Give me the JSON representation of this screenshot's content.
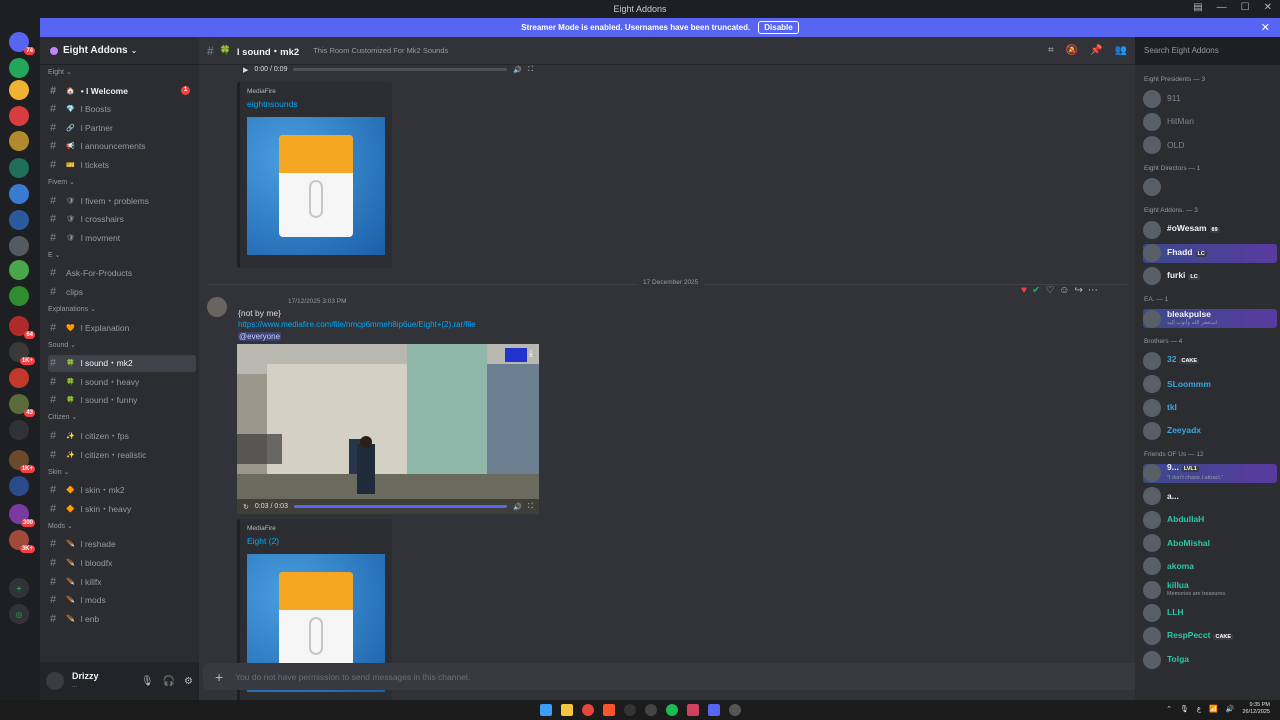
{
  "window": {
    "title": "Eight Addons"
  },
  "banner": {
    "text": "Streamer Mode is enabled. Usernames have been truncated.",
    "button": "Disable"
  },
  "server_rail": [
    {
      "badge": "74",
      "color": "#5865f2"
    },
    {
      "badge": "",
      "color": "#23a55a"
    },
    {
      "badge": "",
      "color": "#f0b232"
    },
    {
      "badge": "",
      "color": "#d83c3e"
    },
    {
      "badge": "",
      "color": "#b08a2c"
    },
    {
      "badge": "",
      "color": "#1f6e5a"
    },
    {
      "badge": "",
      "color": "#3a7ad0"
    },
    {
      "badge": "",
      "color": "#2a5a9c"
    },
    {
      "badge": "",
      "color": "#555a60"
    },
    {
      "badge": "",
      "color": "#4aa64a"
    },
    {
      "badge": "",
      "color": "#2f8c2f"
    },
    {
      "badge": "64",
      "color": "#b02a2a"
    },
    {
      "badge": "1K+",
      "color": "#3a3a3a"
    },
    {
      "badge": "",
      "color": "#c0392b"
    },
    {
      "badge": "43",
      "color": "#5a6a3a"
    },
    {
      "badge": "",
      "color": "#303238"
    },
    {
      "badge": "1K+",
      "color": "#6a4a2a"
    },
    {
      "badge": "",
      "color": "#2a4a8a"
    },
    {
      "badge": "300",
      "color": "#7a3aa0"
    },
    {
      "badge": "3K+",
      "color": "#a04a3a"
    }
  ],
  "sidebar": {
    "server_name": "Eight Addons",
    "categories": [
      {
        "name": "Eight",
        "channels": [
          {
            "name": "• l Welcome",
            "icon": "🏠",
            "bold": true,
            "badge": "1"
          },
          {
            "name": "l Boosts",
            "icon": "💎"
          },
          {
            "name": "l Partner",
            "icon": "🔗"
          },
          {
            "name": "l announcements",
            "icon": "📢"
          },
          {
            "name": "l tickets",
            "icon": "🎫"
          }
        ]
      },
      {
        "name": "Fivem",
        "channels": [
          {
            "name": "l fivem・problems",
            "icon": "🛡"
          },
          {
            "name": "l crosshairs",
            "icon": "🛡"
          },
          {
            "name": "l movment",
            "icon": "🛡"
          }
        ]
      },
      {
        "name": "E",
        "channels": [
          {
            "name": "Ask-For-Products",
            "icon": ""
          },
          {
            "name": "clips",
            "icon": ""
          }
        ]
      },
      {
        "name": "Explanations",
        "channels": [
          {
            "name": "l Explanation",
            "icon": "🧡"
          }
        ]
      },
      {
        "name": "Sound",
        "channels": [
          {
            "name": "l sound・mk2",
            "icon": "🍀",
            "active": true
          },
          {
            "name": "l sound・heavy",
            "icon": "🍀"
          },
          {
            "name": "l sound・funny",
            "icon": "🍀"
          }
        ]
      },
      {
        "name": "Citizen",
        "channels": [
          {
            "name": "l citizen・fps",
            "icon": "✨"
          },
          {
            "name": "l citizen・realistic",
            "icon": "✨"
          }
        ]
      },
      {
        "name": "Skin",
        "channels": [
          {
            "name": "l skin・mk2",
            "icon": "🔶"
          },
          {
            "name": "l skin・heavy",
            "icon": "🔶"
          }
        ]
      },
      {
        "name": "Mods",
        "channels": [
          {
            "name": "l reshade",
            "icon": "🪶"
          },
          {
            "name": "l bloodfx",
            "icon": "🪶"
          },
          {
            "name": "l killfx",
            "icon": "🪶"
          },
          {
            "name": "l mods",
            "icon": "🪶"
          },
          {
            "name": "l enb",
            "icon": "🪶"
          }
        ]
      }
    ],
    "user": {
      "name": "Drizzy",
      "status": "..."
    }
  },
  "header": {
    "channel": "l sound・mk2",
    "topic": "This Room Customized For Mk2 Sounds"
  },
  "search": {
    "placeholder": "Search Eight Addons"
  },
  "chat": {
    "audio1": {
      "time": "0:00 / 0:09",
      "progress": 0
    },
    "embed1": {
      "provider": "MediaFire",
      "title": "eightnsounds"
    },
    "date_divider": "17 December 2025",
    "message": {
      "timestamp": "17/12/2025 3:03 PM",
      "text": "{not by me}",
      "url": "https://www.mediafire.com/file/nmcp6mmeh8ip6ue/Eight+(2).rar/file",
      "mention": "@everyone"
    },
    "video": {
      "time": "0:03 / 0:03",
      "progress": 1
    },
    "embed2": {
      "provider": "MediaFire",
      "title": "Eight (2)"
    },
    "input_placeholder": "You do not have permission to send messages in this channel."
  },
  "members": [
    {
      "group": "Eight Presidents — 3",
      "list": [
        {
          "name": "911",
          "color": "#80848e"
        },
        {
          "name": "HitMan",
          "color": "#80848e"
        },
        {
          "name": "OLD",
          "color": "#80848e"
        }
      ]
    },
    {
      "group": "Eight Directors — 1",
      "list": [
        {
          "name": "",
          "color": "#80848e"
        }
      ]
    },
    {
      "group": "Eight Addons. — 3",
      "list": [
        {
          "name": "#oWesam",
          "color": "#f2f3f5",
          "tag": "89"
        },
        {
          "name": "Fhadd",
          "color": "#f2f3f5",
          "tag": "LC",
          "highlight": true
        },
        {
          "name": "furki",
          "color": "#f2f3f5",
          "tag": "LC"
        }
      ]
    },
    {
      "group": "EA. — 1",
      "list": [
        {
          "name": "bleakpulse",
          "color": "#f2f3f5",
          "sub": "استغفر الله وأتوب إليه",
          "highlight": true
        }
      ]
    },
    {
      "group": "Brothers — 4",
      "list": [
        {
          "name": "32",
          "color": "#3ba5e0",
          "tag": "CAKE"
        },
        {
          "name": "SLoommm",
          "color": "#3ba5e0"
        },
        {
          "name": "tkl",
          "color": "#3ba5e0"
        },
        {
          "name": "Zeeyadx",
          "color": "#3ba5e0"
        }
      ]
    },
    {
      "group": "Friends OF Us — 12",
      "list": [
        {
          "name": "9...",
          "color": "#f2f3f5",
          "tag": "LVL1",
          "sub": "\"I don't chase I attract.\"",
          "highlight": true
        },
        {
          "name": "a...",
          "color": "#f2f3f5"
        },
        {
          "name": "AbdullaH",
          "color": "#2dc7a8"
        },
        {
          "name": "AboMishal",
          "color": "#2dc7a8"
        },
        {
          "name": "akoma",
          "color": "#2dc7a8"
        },
        {
          "name": "killua",
          "color": "#2dc7a8",
          "sub": "Memories are treasures."
        },
        {
          "name": "LLH",
          "color": "#2dc7a8"
        },
        {
          "name": "RespPecct",
          "color": "#2dc7a8",
          "tag": "CAKE"
        },
        {
          "name": "Tolga",
          "color": "#2dc7a8"
        }
      ]
    }
  ],
  "taskbar": {
    "time": "9:35 PM",
    "date": "26/12/2025",
    "lang": "ع"
  }
}
